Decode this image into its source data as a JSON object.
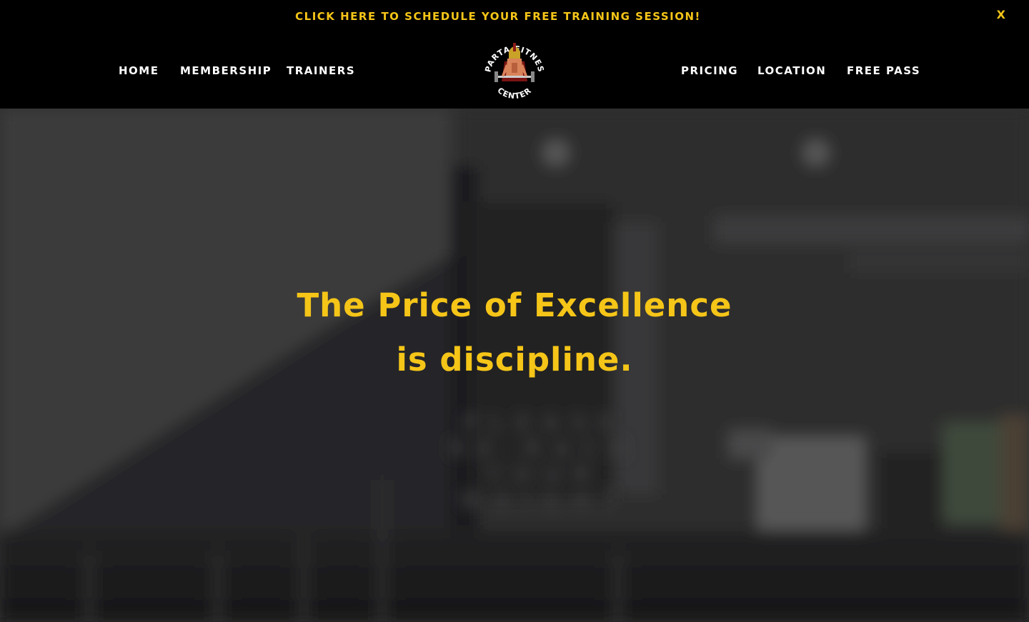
{
  "announcement": {
    "text": "CLICK HERE TO SCHEDULE YOUR FREE TRAINING SESSION!",
    "close_label": "X",
    "color": "#f5c518"
  },
  "nav": {
    "left": [
      {
        "label": "HOME"
      },
      {
        "label": "MEMBERSHIP"
      },
      {
        "label": "TRAINERS"
      }
    ],
    "right": [
      {
        "label": "PRICING"
      },
      {
        "label": "LOCATION"
      },
      {
        "label": "FREE PASS"
      }
    ]
  },
  "logo": {
    "top_text": "SPARTA FITNESS",
    "bottom_text": "CENTER"
  },
  "hero": {
    "line1": "The Price of Excellence",
    "line2": "is discipline.",
    "sign_lines": [
      "PLEASE",
      "RE-RACK",
      "YOUR",
      "WEIGHT"
    ],
    "accent_color": "#f5c518"
  }
}
